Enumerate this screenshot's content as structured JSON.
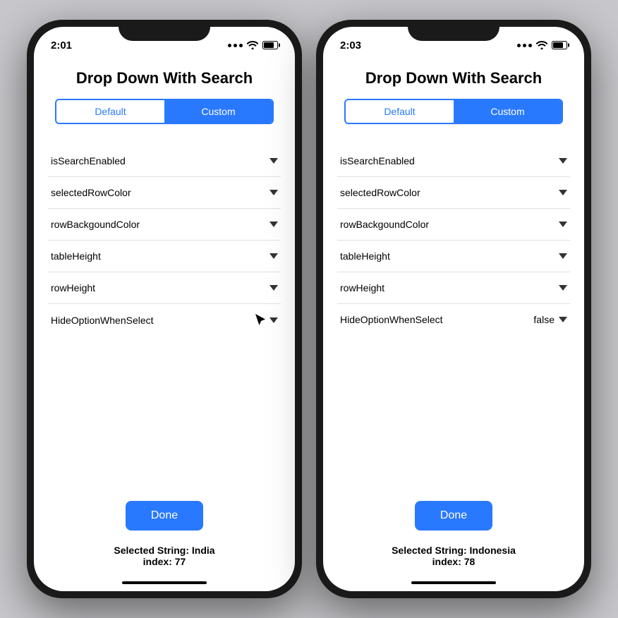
{
  "colors": {
    "blue": "#2979ff",
    "black": "#000000",
    "white": "#ffffff",
    "gray_bg": "#c8c8cc"
  },
  "phone_left": {
    "status": {
      "time": "2:01",
      "dots": [
        "•",
        "•",
        "•"
      ],
      "wifi": true,
      "battery": true
    },
    "title": "Drop Down With Search",
    "segment": {
      "default_label": "Default",
      "custom_label": "Custom",
      "active": "custom"
    },
    "options": [
      {
        "label": "isSearchEnabled",
        "value": "",
        "has_arrow": true
      },
      {
        "label": "selectedRowColor",
        "value": "",
        "has_arrow": true
      },
      {
        "label": "rowBackgoundColor",
        "value": "",
        "has_arrow": true
      },
      {
        "label": "tableHeight",
        "value": "",
        "has_arrow": true
      },
      {
        "label": "rowHeight",
        "value": "",
        "has_arrow": true
      },
      {
        "label": "HideOptionWhenSelect",
        "value": "",
        "has_arrow": true,
        "has_cursor": true
      }
    ],
    "done_label": "Done",
    "selected_string": "Selected String: India\nindex: 77"
  },
  "phone_right": {
    "status": {
      "time": "2:03",
      "dots": [
        "•",
        "•",
        "•"
      ],
      "wifi": true,
      "battery": true
    },
    "title": "Drop Down With Search",
    "segment": {
      "default_label": "Default",
      "custom_label": "Custom",
      "active": "custom"
    },
    "options": [
      {
        "label": "isSearchEnabled",
        "value": "",
        "has_arrow": true
      },
      {
        "label": "selectedRowColor",
        "value": "",
        "has_arrow": true
      },
      {
        "label": "rowBackgoundColor",
        "value": "",
        "has_arrow": true
      },
      {
        "label": "tableHeight",
        "value": "",
        "has_arrow": true
      },
      {
        "label": "rowHeight",
        "value": "",
        "has_arrow": true
      },
      {
        "label": "HideOptionWhenSelect",
        "value": "false",
        "has_arrow": true
      }
    ],
    "done_label": "Done",
    "selected_string": "Selected String: Indonesia\nindex: 78"
  }
}
